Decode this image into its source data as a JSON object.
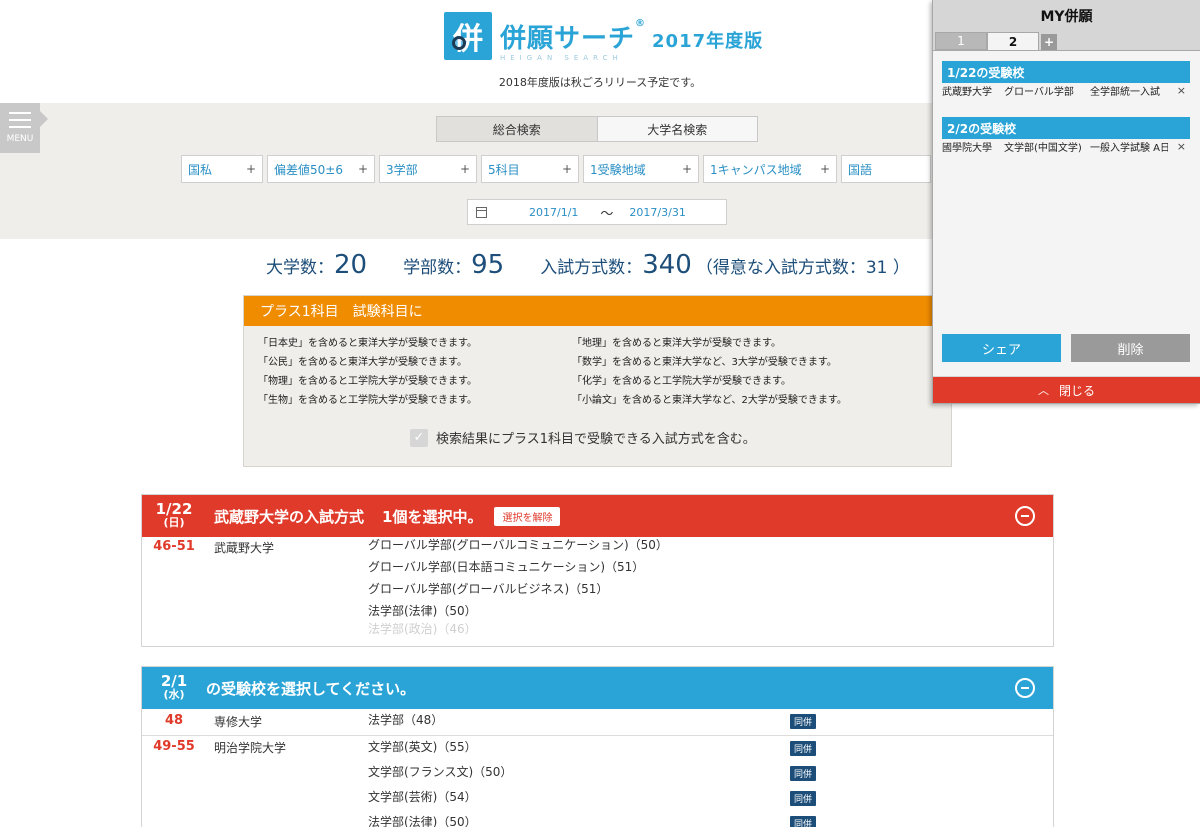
{
  "header": {
    "logo_mark": "併",
    "logo_title": "併願サーチ",
    "logo_reg": "®",
    "logo_year": "2017年度版",
    "logo_sub": "HEIGAN SEARCH",
    "release_note": "2018年度版は秋ごろリリース予定です。"
  },
  "menu": {
    "label": "MENU"
  },
  "search": {
    "tabs": [
      {
        "label": "総合検索"
      },
      {
        "label": "大学名検索"
      }
    ],
    "filters": [
      {
        "label": "国私"
      },
      {
        "label": "偏差値50±6"
      },
      {
        "label": "3学部"
      },
      {
        "label": "5科目"
      },
      {
        "label": "1受験地域"
      },
      {
        "label": "1キャンパス地域"
      },
      {
        "label": "国語"
      }
    ],
    "plus_glyph": "+",
    "date_from": "2017/1/1",
    "tilde": "〜",
    "date_to": "2017/3/31"
  },
  "counts": {
    "uni_label": "大学数：",
    "uni_value": "20",
    "dept_label": "学部数：",
    "dept_value": "95",
    "method_label": "入試方式数：",
    "method_value": "340",
    "extra": "（得意な入試方式数：31 ）"
  },
  "plus_subject": {
    "title": "プラス1科目　試験科目に",
    "left": [
      "「日本史」を含めると東洋大学が受験できます。",
      "「公民」を含めると東洋大学が受験できます。",
      "「物理」を含めると工学院大学が受験できます。",
      "「生物」を含めると工学院大学が受験できます。"
    ],
    "right": [
      "「地理」を含めると東洋大学が受験できます。",
      "「数学」を含めると東洋大学など、3大学が受験できます。",
      "「化学」を含めると工学院大学が受験できます。",
      "「小論文」を含めると東洋大学など、2大学が受験できます。"
    ],
    "check_mark": "✓",
    "checkbox_label": "検索結果にプラス1科目で受験できる入試方式を含む。"
  },
  "section1": {
    "date": "1/22",
    "weekday": "(日)",
    "title_uni": "武蔵野大学",
    "title_rest": "の入試方式",
    "count": "1個を選択中。",
    "clear": "選択を解除",
    "rows": [
      {
        "deviation": "46-51",
        "university": "武蔵野大学",
        "departments": [
          "グローバル学部(グローバルコミュニケーション)（50）",
          "グローバル学部(日本語コミュニケーション)（51）",
          "グローバル学部(グローバルビジネス)（51）",
          "法学部(法律)（50）",
          "法学部(政治)（46）"
        ]
      }
    ]
  },
  "section2": {
    "date": "2/1",
    "weekday": "(水)",
    "title": "の受験校を選択してください。",
    "rows": [
      {
        "deviation": "48",
        "university": "専修大学",
        "departments": [
          "法学部（48）"
        ],
        "badge": "同併"
      },
      {
        "deviation": "49-55",
        "university": "明治学院大学",
        "departments": [
          "文学部(英文)（55）",
          "文学部(フランス文)（50）",
          "文学部(芸術)（54）",
          "法学部(法律)（50）"
        ],
        "badge": "同併"
      }
    ]
  },
  "my_panel": {
    "title": "MY併願",
    "tabs": [
      "1",
      "2"
    ],
    "add_tab": "+",
    "groups": [
      {
        "head": "1/22の受験校",
        "items": [
          {
            "uni": "武蔵野大学",
            "dept": "グローバル学部",
            "method": "全学部統一入試"
          }
        ]
      },
      {
        "head": "2/2の受験校",
        "items": [
          {
            "uni": "國學院大學",
            "dept": "文学部(中国文学)",
            "method": "一般入学試験 A日程"
          }
        ]
      }
    ],
    "remove_glyph": "×",
    "share": "シェア",
    "delete": "削除",
    "close": "閉じる",
    "close_chevron": "︿"
  }
}
